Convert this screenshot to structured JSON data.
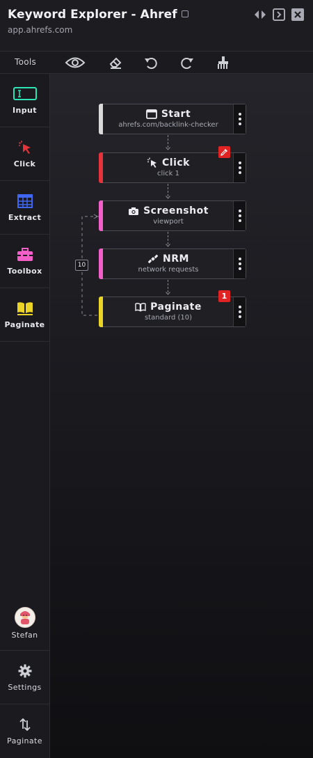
{
  "header": {
    "title": "Keyword Explorer - Ahref",
    "url": "app.ahrefs.com"
  },
  "toolbar": {
    "label": "Tools",
    "tools": [
      "eye-icon",
      "eraser-icon",
      "undo-icon",
      "redo-icon",
      "broom-icon"
    ]
  },
  "sidebar": {
    "items": [
      {
        "label": "Input",
        "icon": "input-icon",
        "color": "#2ee6b5"
      },
      {
        "label": "Click",
        "icon": "pointer-icon",
        "color": "#e5333b"
      },
      {
        "label": "Extract",
        "icon": "table-icon",
        "color": "#3f67f0"
      },
      {
        "label": "Toolbox",
        "icon": "toolbox-icon",
        "color": "#f25fc8"
      },
      {
        "label": "Paginate",
        "icon": "book-icon",
        "color": "#ead425"
      }
    ],
    "user": {
      "label": "Stefan"
    },
    "settings": {
      "label": "Settings"
    },
    "bottom_paginate": {
      "label": "Paginate"
    }
  },
  "flow": {
    "nodes": [
      {
        "name": "Start",
        "sub": "ahrefs.com/backlink-checker",
        "icon": "browser-icon",
        "color": "#d9d9d9"
      },
      {
        "name": "Click",
        "sub": "click 1",
        "icon": "pointer-icon",
        "color": "#e5333b",
        "badge_icon": "eyedropper-icon"
      },
      {
        "name": "Screenshot",
        "sub": "viewport",
        "icon": "camera-icon",
        "color": "#f25fc8"
      },
      {
        "name": "NRM",
        "sub": "network requests",
        "icon": "satellite-icon",
        "color": "#f25fc8"
      },
      {
        "name": "Paginate",
        "sub": "standard (10)",
        "icon": "book-icon",
        "color": "#ead425",
        "badge": "1"
      }
    ],
    "loop_count": "10"
  },
  "colors": {
    "accent_red": "#e02424",
    "border": "#4a4a52"
  }
}
